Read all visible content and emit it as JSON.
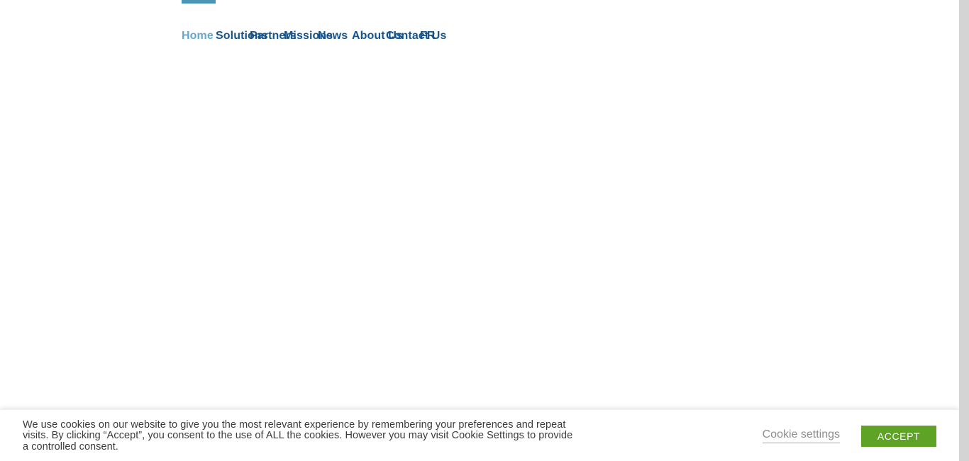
{
  "header": {
    "nav": {
      "items": [
        {
          "label": "Home",
          "name": "home",
          "active": true
        },
        {
          "label": "Solutions",
          "name": "solutions",
          "active": false
        },
        {
          "label": "Partners",
          "name": "partners",
          "active": false
        },
        {
          "label": "Missions",
          "name": "missions",
          "active": false
        },
        {
          "label": "News",
          "name": "news",
          "active": false
        },
        {
          "label": "About Us",
          "name": "about-us",
          "active": false
        },
        {
          "label": "Contact Us",
          "name": "contact-us",
          "active": false
        },
        {
          "label": "FR",
          "name": "fr",
          "active": false
        }
      ],
      "active_indicator_color": "#4a94b5",
      "active_link_color": "#6ba7c6",
      "link_color": "#17548c"
    }
  },
  "main": {
    "content": ""
  },
  "cookie_banner": {
    "message_lines": [
      "We use cookies on our website to give you the most relevant experience by remembering your preferences and repeat",
      "visits. By clicking “Accept”, you consent to the use of ALL the cookies. However you may visit Cookie Settings to provide",
      "a controlled consent."
    ],
    "message_full": "We use cookies on our website to give you the most relevant experience by remembering your preferences and repeat visits. By clicking “Accept”, you consent to the use of ALL the cookies. However you may visit Cookie Settings to provide a controlled consent.",
    "settings_link_label": "Cookie settings",
    "accept_button_label": "ACCEPT",
    "accept_button_color": "#5ea226",
    "text_color": "#3b3b3b",
    "link_color": "#8e8e8e"
  },
  "scrollbar": {
    "track_color": "#d4d4d4",
    "thumb_color": "#d4d4d4"
  }
}
